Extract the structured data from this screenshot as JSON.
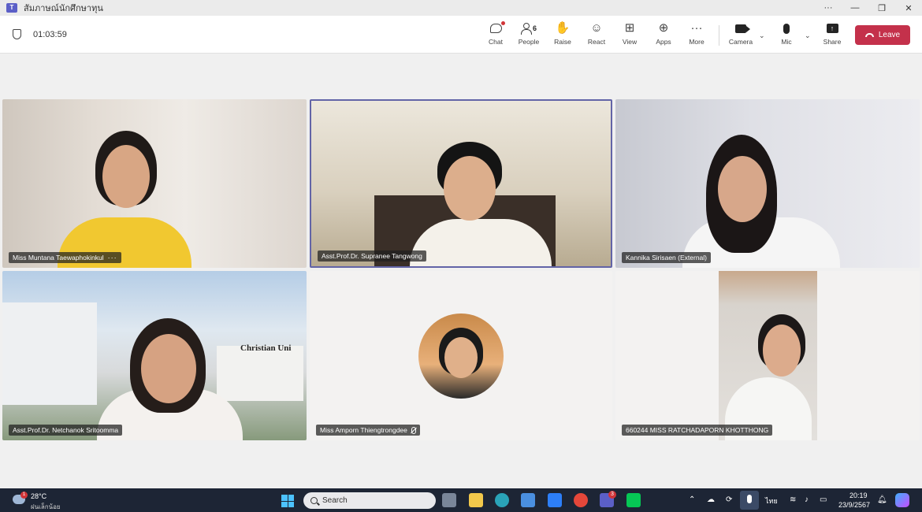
{
  "window": {
    "title": "สัมภาษณ์นักศึกษาทุน",
    "controls": [
      "···",
      "—",
      "❐",
      "✕"
    ]
  },
  "toolbar": {
    "timer": "01:03:59",
    "people_count": "6",
    "buttons": {
      "chat": "Chat",
      "people": "People",
      "raise": "Raise",
      "react": "React",
      "view": "View",
      "apps": "Apps",
      "more": "More",
      "camera": "Camera",
      "mic": "Mic",
      "share": "Share"
    },
    "leave_label": "Leave",
    "leave_color": "#c4314b"
  },
  "participants": [
    {
      "name": "Miss Muntana Taewaphokinkul",
      "has_more": true
    },
    {
      "name": "Asst.Prof.Dr. Supranee Tangwong",
      "active_speaker": true
    },
    {
      "name": "Kannika Sirisaen (External)"
    },
    {
      "name": "Asst.Prof.Dr. Netchanok Sritoomma"
    },
    {
      "name": "Miss Amporn Thiengtrongdee",
      "muted": true
    },
    {
      "name": "660244 MISS RATCHADAPORN KHOTTHONG"
    }
  ],
  "building_sign": "Christian Uni",
  "taskbar": {
    "weather_temp": "28°C",
    "weather_desc": "ฝนเล็กน้อย",
    "weather_badge": "1",
    "search_placeholder": "Search",
    "teams_badge": "3",
    "language": "ไทย",
    "time": "20:19",
    "date": "23/9/2567"
  },
  "colors": {
    "active_speaker_border": "#6264a7",
    "taskbar_bg": "#1d2535"
  }
}
